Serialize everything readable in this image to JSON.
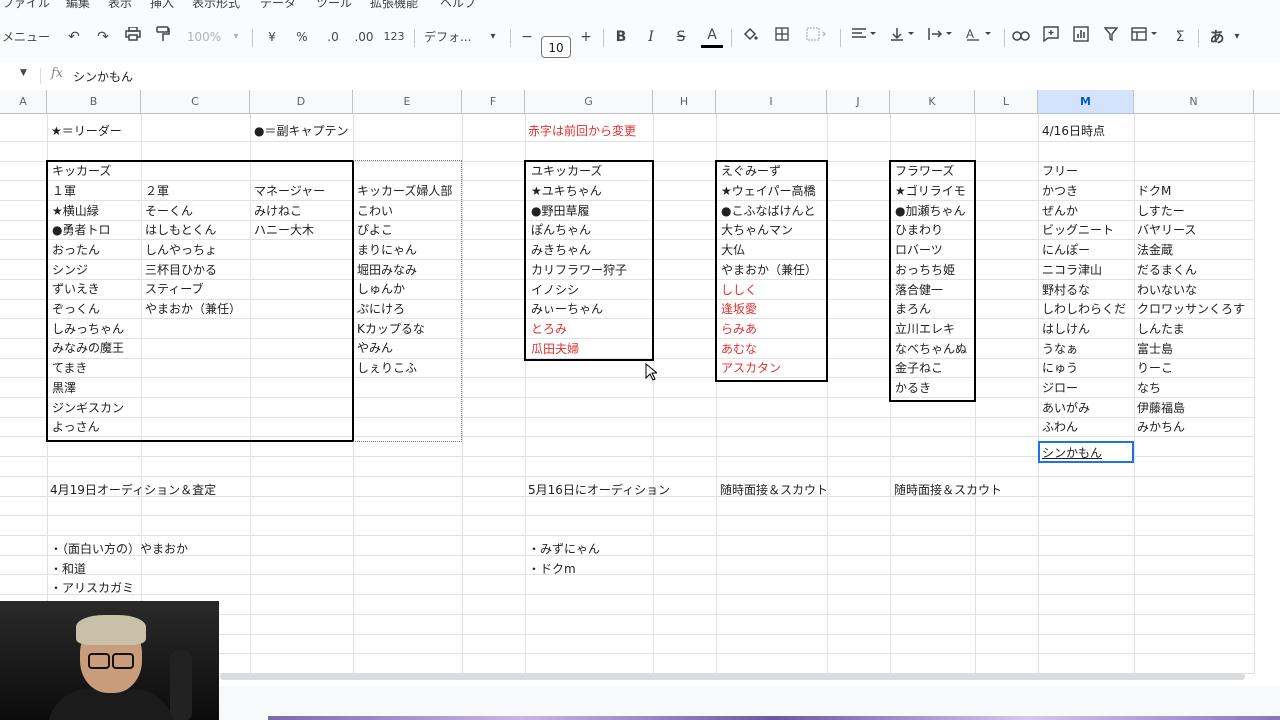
{
  "menu": [
    "ファイル",
    "編集",
    "表示",
    "挿入",
    "表示形式",
    "データ",
    "ツール",
    "拡張機能",
    "ヘルプ"
  ],
  "toolbar": {
    "menu_label": "メニュー",
    "zoom": "100%",
    "currency": "¥",
    "percent": "%",
    "dec_dec": ".0",
    "inc_dec": ".00",
    "num_format": "123",
    "font": "デフォ...",
    "font_size": "10",
    "minus": "−",
    "plus": "+",
    "bold": "B",
    "italic": "I",
    "strike": "S",
    "textcolor": "A",
    "ime": "あ"
  },
  "formula_bar": {
    "fx": "fx",
    "value": "シンかもん"
  },
  "columns": [
    "A",
    "B",
    "C",
    "D",
    "E",
    "F",
    "G",
    "H",
    "I",
    "J",
    "K",
    "L",
    "M",
    "N"
  ],
  "selected_column": "M",
  "cells": {
    "b_leader": "★＝リーダー",
    "d_vice": "●＝副キャプテン",
    "g_note": "赤字は前回から変更",
    "m_date": "4/16日時点",
    "team1": {
      "title": "キッカーズ",
      "col1_header": "１軍",
      "col1": [
        "★横山緑",
        "●勇者トロ",
        "おったん",
        "シンジ",
        "ずいえき",
        "ぞっくん",
        "しみっちゃん",
        "みなみの魔王",
        "てまき",
        "黒澤",
        "ジンギスカン",
        "よっさん"
      ],
      "col2_header": "２軍",
      "col2": [
        "そーくん",
        "はしもとくん",
        "しんやっちょ",
        "三杯目ひかる",
        "スティーブ",
        "やまおか（兼任）"
      ],
      "col3_header": "マネージャー",
      "col3": [
        "みけねこ",
        "ハニー大木"
      ],
      "col4_header": "キッカーズ婦人部",
      "col4": [
        "こわい",
        "ぴよこ",
        "まりにゃん",
        "堀田みなみ",
        "しゅんか",
        "ぷにけろ",
        "Kカップるな",
        "やみん",
        "しぇりこふ"
      ]
    },
    "team2": {
      "title": "ユキッカーズ",
      "members": [
        "★ユキちゃん",
        "●野田草履",
        "ぽんちゃん",
        "みきちゃん",
        "カリフラワー狩子",
        "イノシシ",
        "みぃーちゃん"
      ],
      "members_red": [
        "とろみ",
        "瓜田夫婦"
      ]
    },
    "team3": {
      "title": "えぐみーず",
      "members": [
        "★ウェイパー高橋",
        "●こふなばけんと",
        "大ちゃんマン",
        "大仏",
        "やまおか（兼任）"
      ],
      "members_red": [
        "ししく",
        "逢坂愛",
        "らみあ",
        "あむな",
        "アスカタン"
      ]
    },
    "team4": {
      "title": "フラワーズ",
      "members": [
        "★ゴリライモ",
        "●加瀬ちゃん",
        "ひまわり",
        "ロバーツ",
        "おっちち姫",
        "落合健一",
        "まろん",
        "立川エレキ",
        "なべちゃんぬ",
        "金子ねこ",
        "かるき"
      ]
    },
    "free": {
      "title": "フリー",
      "col_m": [
        "かつき",
        "ぜんか",
        "ビッグニート",
        "にんぽー",
        "ニコラ津山",
        "野村るな",
        "しわしわらくだ",
        "はしけん",
        "うなぁ",
        "にゅう",
        "ジロー",
        "あいがみ",
        "ふわん"
      ],
      "col_n": [
        "ドクM",
        "しすたー",
        "バヤリース",
        "法金蔵",
        "だるまくん",
        "わいないな",
        "クロワッサンくろす",
        "しんたま",
        "富士島",
        "りーこ",
        "なち",
        "伊藤福島",
        "みかちん"
      ],
      "active_value": "シンかもん"
    },
    "row19": {
      "b": "4月19日オーディション＆査定",
      "g": "5月16日にオーディション",
      "i": "随時面接＆スカウト",
      "k": "随時面接＆スカウト"
    },
    "list_b": [
      "・（面白い方の）やまおか",
      "・和道",
      "・アリスカガミ"
    ],
    "list_g": [
      "・みずにゃん",
      "・ドクm"
    ]
  }
}
